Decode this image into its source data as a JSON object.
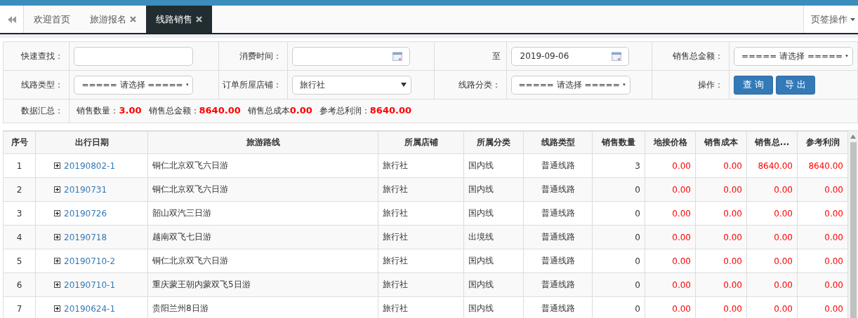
{
  "tabs": [
    {
      "label": "欢迎首页",
      "selected": false,
      "closable": false
    },
    {
      "label": "旅游报名",
      "selected": false,
      "closable": true
    },
    {
      "label": "线路销售",
      "selected": true,
      "closable": true
    }
  ],
  "tab_menu": "页签操作",
  "filters": {
    "rows": [
      [
        {
          "label": "快速查找：",
          "field": {
            "kind": "text"
          }
        },
        {
          "label": "消费时间：",
          "field": {
            "kind": "date"
          }
        },
        {
          "label": "至",
          "field": {
            "kind": "date",
            "value": "2019-09-06"
          }
        },
        {
          "label": "销售总金额：",
          "field": {
            "kind": "select",
            "value": "===== 请选择 ====="
          }
        }
      ],
      [
        {
          "label": "线路类型：",
          "field": {
            "kind": "select",
            "value": "===== 请选择 ====="
          }
        },
        {
          "label": "订单所屋店铺：",
          "field": {
            "kind": "select",
            "value": "旅行社"
          }
        },
        {
          "label": "线路分类：",
          "field": {
            "kind": "select",
            "value": "===== 请选择 ====="
          }
        },
        {
          "label": "操作：",
          "field": {
            "kind": "buttons",
            "buttons": [
              "查 询",
              "导 出"
            ]
          }
        }
      ]
    ],
    "summary_label": "数据汇总：",
    "summary": [
      {
        "label": "销售数量：",
        "value": "3.00"
      },
      {
        "label": "销售总金额：",
        "value": "8640.00"
      },
      {
        "label": "销售总成本",
        "value": "0.00"
      },
      {
        "label": "参考总利润：",
        "value": "8640.00"
      }
    ]
  },
  "table": {
    "columns": [
      {
        "label": "序号",
        "kind": "index"
      },
      {
        "label": "出行日期",
        "kind": "date"
      },
      {
        "label": "旅游路线",
        "kind": "text"
      },
      {
        "label": "所属店铺",
        "kind": "text"
      },
      {
        "label": "所属分类",
        "kind": "text"
      },
      {
        "label": "线路类型",
        "kind": "center"
      },
      {
        "label": "销售数量",
        "kind": "number"
      },
      {
        "label": "地接价格",
        "kind": "money"
      },
      {
        "label": "销售成本",
        "kind": "money"
      },
      {
        "label": "销售总...",
        "kind": "money"
      },
      {
        "label": "参考利润",
        "kind": "money"
      }
    ],
    "rows": [
      {
        "expanded": false,
        "cells": [
          "1",
          "20190802-1",
          "铜仁北京双飞六日游",
          "旅行社",
          "国内线",
          "普通线路",
          "3",
          "0.00",
          "0.00",
          "8640.00",
          "8640.00"
        ]
      },
      {
        "expanded": false,
        "cells": [
          "2",
          "20190731",
          "铜仁北京双飞六日游",
          "旅行社",
          "国内线",
          "普通线路",
          "0",
          "0.00",
          "0.00",
          "0.00",
          "0.00"
        ]
      },
      {
        "expanded": false,
        "cells": [
          "3",
          "20190726",
          "韶山双汽三日游",
          "旅行社",
          "国内线",
          "普通线路",
          "0",
          "0.00",
          "0.00",
          "0.00",
          "0.00"
        ]
      },
      {
        "expanded": false,
        "cells": [
          "4",
          "20190718",
          "越南双飞七日游",
          "旅行社",
          "出境线",
          "普通线路",
          "0",
          "0.00",
          "0.00",
          "0.00",
          "0.00"
        ]
      },
      {
        "expanded": false,
        "cells": [
          "5",
          "20190710-2",
          "铜仁北京双飞六日游",
          "旅行社",
          "国内线",
          "普通线路",
          "0",
          "0.00",
          "0.00",
          "0.00",
          "0.00"
        ]
      },
      {
        "expanded": false,
        "cells": [
          "6",
          "20190710-1",
          "重庆蒙王朝内蒙双飞5日游",
          "旅行社",
          "国内线",
          "普通线路",
          "0",
          "0.00",
          "0.00",
          "0.00",
          "0.00"
        ]
      },
      {
        "expanded": false,
        "cells": [
          "7",
          "20190624-1",
          "贵阳兰州8日游",
          "旅行社",
          "国内线",
          "普通线路",
          "0",
          "0.00",
          "0.00",
          "0.00",
          "0.00"
        ]
      }
    ]
  }
}
